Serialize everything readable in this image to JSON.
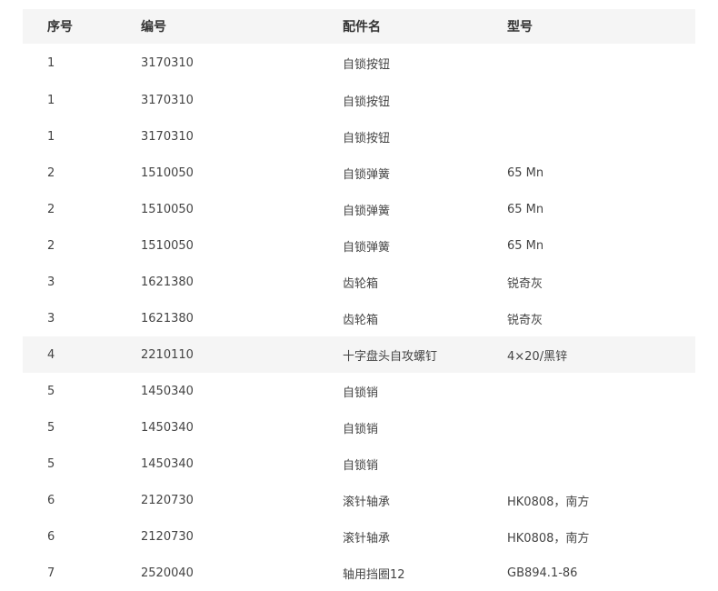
{
  "columns": [
    "序号",
    "编号",
    "配件名",
    "型号"
  ],
  "rows": [
    {
      "no": "1",
      "code": "3170310",
      "name": "自锁按钮",
      "model": ""
    },
    {
      "no": "1",
      "code": "3170310",
      "name": "自锁按钮",
      "model": ""
    },
    {
      "no": "1",
      "code": "3170310",
      "name": "自锁按钮",
      "model": ""
    },
    {
      "no": "2",
      "code": "1510050",
      "name": "自锁弹簧",
      "model": "65 Mn"
    },
    {
      "no": "2",
      "code": "1510050",
      "name": "自锁弹簧",
      "model": "65 Mn"
    },
    {
      "no": "2",
      "code": "1510050",
      "name": "自锁弹簧",
      "model": "65 Mn"
    },
    {
      "no": "3",
      "code": "1621380",
      "name": "齿轮箱",
      "model": "锐奇灰"
    },
    {
      "no": "3",
      "code": "1621380",
      "name": "齿轮箱",
      "model": "锐奇灰"
    },
    {
      "no": "4",
      "code": "2210110",
      "name": "十字盘头自攻螺钉",
      "model": "4×20/黑锌",
      "highlighted": true
    },
    {
      "no": "5",
      "code": "1450340",
      "name": "自锁销",
      "model": ""
    },
    {
      "no": "5",
      "code": "1450340",
      "name": "自锁销",
      "model": ""
    },
    {
      "no": "5",
      "code": "1450340",
      "name": "自锁销",
      "model": ""
    },
    {
      "no": "6",
      "code": "2120730",
      "name": "滚针轴承",
      "model": "HK0808，南方"
    },
    {
      "no": "6",
      "code": "2120730",
      "name": "滚针轴承",
      "model": "HK0808，南方"
    },
    {
      "no": "7",
      "code": "2520040",
      "name": "轴用挡圈12",
      "model": "GB894.1-86"
    }
  ],
  "colors": {
    "header_bg": "#f5f5f5",
    "highlight_bg": "#f5f5f5",
    "text": "#444444"
  }
}
